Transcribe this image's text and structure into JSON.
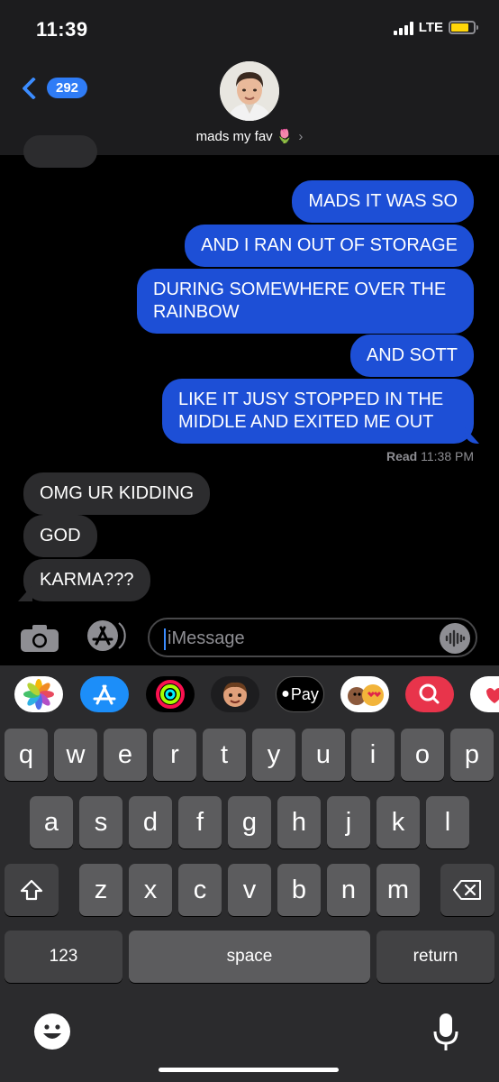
{
  "status_bar": {
    "time": "11:39",
    "network": "LTE",
    "battery_color": "#ffd60a"
  },
  "header": {
    "back_count": "292",
    "contact_name": "mads my fav",
    "contact_emoji": "🌷",
    "chevron": "›"
  },
  "messages": {
    "sent": [
      "MADS IT WAS SO",
      "AND I RAN OUT OF STORAGE",
      "DURING SOMEWHERE OVER THE RAINBOW",
      "AND SOTT",
      "LIKE IT JUSY STOPPED IN THE MIDDLE AND EXITED ME OUT"
    ],
    "read_label": "Read",
    "read_time": "11:38 PM",
    "received": [
      "OMG UR KIDDING",
      "GOD",
      "KARMA???"
    ]
  },
  "input": {
    "placeholder": "iMessage"
  },
  "app_drawer": {
    "apps": [
      "photos-app-icon",
      "app-store-app-icon",
      "activity-app-icon",
      "memoji-app-icon",
      "apple-pay-app-icon",
      "animoji-app-icon",
      "search-images-app-icon",
      "stickers-app-icon"
    ],
    "apple_pay_label": "Pay"
  },
  "keyboard": {
    "row1": [
      "q",
      "w",
      "e",
      "r",
      "t",
      "y",
      "u",
      "i",
      "o",
      "p"
    ],
    "row2": [
      "a",
      "s",
      "d",
      "f",
      "g",
      "h",
      "j",
      "k",
      "l"
    ],
    "row3": [
      "z",
      "x",
      "c",
      "v",
      "b",
      "n",
      "m"
    ],
    "numbers": "123",
    "space": "space",
    "return": "return"
  },
  "colors": {
    "sent_bubble": "#1d4fd6",
    "received_bubble": "#2c2c2e",
    "accent": "#3b8cff"
  }
}
